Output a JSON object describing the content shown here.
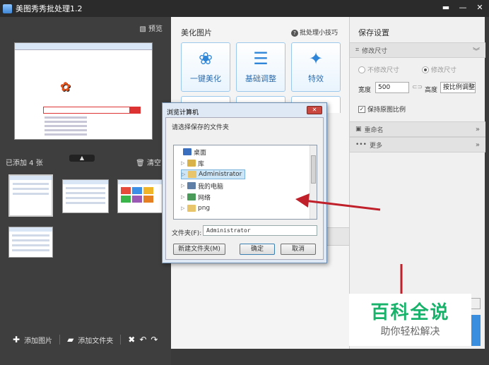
{
  "app": {
    "title": "美图秀秀批处理1.2"
  },
  "left": {
    "preview_label": "预览",
    "added_label": "已添加 4 张",
    "clear_label": "清空",
    "add_image": "添加图片",
    "add_folder": "添加文件夹"
  },
  "center": {
    "title": "美化图片",
    "tips": "批处理小技巧",
    "tiles": [
      {
        "label": "一键美化",
        "icon": "tulip-icon"
      },
      {
        "label": "基础调整",
        "icon": "sliders-icon"
      },
      {
        "label": "特效",
        "icon": "magic-wand-icon"
      }
    ]
  },
  "right": {
    "title": "保存设置",
    "resize_section": "修改尺寸",
    "no_resize": "不修改尺寸",
    "resize": "修改尺寸",
    "width_label": "宽度",
    "width_value": "500",
    "height_label": "高度",
    "height_value": "按比例调整",
    "keep_ratio": "保持原图比例",
    "rename_section": "重命名",
    "more_section": "更多"
  },
  "dialog": {
    "title": "浏览计算机",
    "prompt": "请选择保存的文件夹",
    "tree": [
      {
        "label": "桌面",
        "icon": "desktop-icon"
      },
      {
        "label": "库",
        "icon": "library-icon"
      },
      {
        "label": "Administrator",
        "icon": "user-folder-icon"
      },
      {
        "label": "我的电脑",
        "icon": "computer-icon"
      },
      {
        "label": "网络",
        "icon": "network-icon"
      },
      {
        "label": "png",
        "icon": "folder-icon"
      }
    ],
    "folder_label": "文件夹(F):",
    "folder_value": "Administrator",
    "new_folder": "新建文件夹(M)",
    "ok": "确定",
    "cancel": "取消"
  },
  "watermark": {
    "line1": "百科全说",
    "line2": "助你轻松解决"
  },
  "colors": {
    "accent": "#2f86d8",
    "arrow": "#c0202a",
    "watermark_green": "#19b26b"
  }
}
